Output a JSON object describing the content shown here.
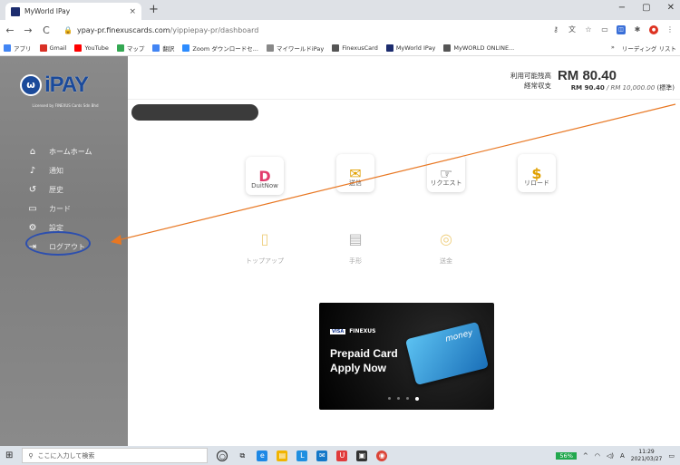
{
  "browser": {
    "tab_title": "MyWorld IPay",
    "tab_close": "×",
    "new_tab": "+",
    "window_controls": [
      "−",
      "▢",
      "✕"
    ],
    "url_host": "ypay-pr.finexuscards.com",
    "url_path": "/yippiepay-pr/dashboard"
  },
  "bookmarks": {
    "items": [
      {
        "label": "アプリ",
        "color": "#4285f4"
      },
      {
        "label": "Gmail",
        "color": "#d93025"
      },
      {
        "label": "YouTube",
        "color": "#ff0000"
      },
      {
        "label": "マップ",
        "color": "#34a853"
      },
      {
        "label": "翻訳",
        "color": "#4285f4"
      },
      {
        "label": "Zoom ダウンロードセ...",
        "color": "#2d8cff"
      },
      {
        "label": "マイワールドiPay",
        "color": "#888888"
      },
      {
        "label": "FinexusCard",
        "color": "#555555"
      },
      {
        "label": "MyWorld IPay",
        "color": "#1c2c6e"
      },
      {
        "label": "MyWORLD ONLINE...",
        "color": "#555555"
      }
    ],
    "overflow": "»",
    "reading_list": "リーディング リスト"
  },
  "sidebar": {
    "logo_text": "iPAY",
    "logo_mark": "ω",
    "logo_sub": "Licensed by FINEXUS Cards Sdn Bhd",
    "items": [
      {
        "label": "ホームホーム",
        "icon": "home-icon",
        "glyph": "⌂"
      },
      {
        "label": "通知",
        "icon": "bell-icon",
        "glyph": "♪"
      },
      {
        "label": "歴史",
        "icon": "history-icon",
        "glyph": "↺"
      },
      {
        "label": "カード",
        "icon": "card-icon",
        "glyph": "▭"
      },
      {
        "label": "設定",
        "icon": "gear-icon",
        "glyph": "⚙"
      },
      {
        "label": "ログアウト",
        "icon": "logout-icon",
        "glyph": "⇥"
      }
    ]
  },
  "balance": {
    "available_label": "利用可能残高",
    "spend_label": "経常収支",
    "amount": "RM 80.40",
    "current": "RM 90.40",
    "limit": "/ RM 10,000.00",
    "tier": "(標準)"
  },
  "tiles": [
    {
      "label": "DuitNow",
      "glyph": "D",
      "color": "#e23b6c",
      "sub": "DuitNow",
      "faded": false
    },
    {
      "label": "送信",
      "glyph": "✉",
      "color": "#e0a000",
      "faded": false
    },
    {
      "label": "リクエスト",
      "glyph": "☞",
      "color": "#444444",
      "faded": false
    },
    {
      "label": "リロード",
      "glyph": "$",
      "color": "#e0a000",
      "faded": false
    },
    {
      "label": "トップアップ",
      "glyph": "▯",
      "color": "#e0a000",
      "faded": true
    },
    {
      "label": "手形",
      "glyph": "▤",
      "color": "#666666",
      "faded": true
    },
    {
      "label": "送金",
      "glyph": "◎",
      "color": "#e0a000",
      "faded": true
    }
  ],
  "promo": {
    "brand": "FINEXUS",
    "visa": "VISA",
    "title_line1": "Prepaid Card",
    "title_line2": "Apply Now",
    "card_text": "money",
    "slide_count": 4,
    "active_slide": 3
  },
  "taskbar": {
    "search_placeholder": "ここに入力して検索",
    "battery": "56%",
    "ime": "A",
    "time": "11:29",
    "date": "2021/03/27"
  },
  "colors": {
    "sidebar_bg": "#8a8a8a",
    "brand_blue": "#1b4a9a",
    "annotation_arrow": "#e87722",
    "annotation_ellipse": "#2d4fae"
  }
}
